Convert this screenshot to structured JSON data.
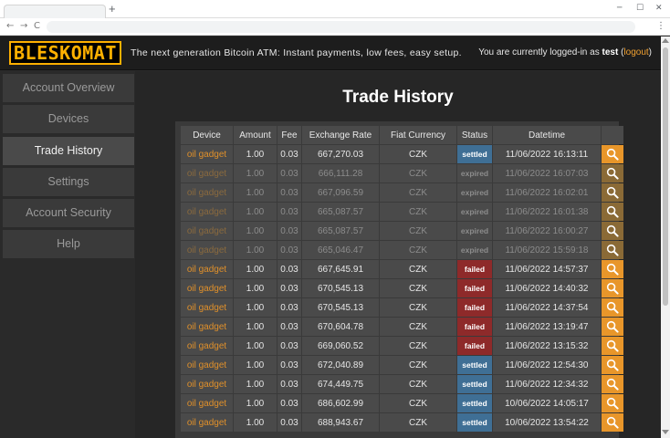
{
  "browser": {
    "new_tab": "+",
    "minimize": "─",
    "maximize": "☐",
    "close": "✕",
    "back": "←",
    "forward": "→",
    "reload": "C",
    "menu": "⋮"
  },
  "header": {
    "logo": "BLESKOMAT",
    "tagline": "The next generation Bitcoin ATM: Instant payments, low fees, easy setup.",
    "login_prefix": "You are currently logged-in as ",
    "username": "test",
    "logout_open": " (",
    "logout_label": "logout",
    "logout_close": ")"
  },
  "sidebar": {
    "items": [
      {
        "label": "Account Overview"
      },
      {
        "label": "Devices"
      },
      {
        "label": "Trade History"
      },
      {
        "label": "Settings"
      },
      {
        "label": "Account Security"
      },
      {
        "label": "Help"
      }
    ]
  },
  "main": {
    "title": "Trade History",
    "columns": [
      "Device",
      "Amount",
      "Fee",
      "Exchange Rate",
      "Fiat Currency",
      "Status",
      "Datetime"
    ],
    "rows": [
      {
        "device": "oil gadget",
        "amount": "1.00",
        "fee": "0.03",
        "rate": "667,270.03",
        "fiat": "CZK",
        "status": "settled",
        "datetime": "11/06/2022 16:13:11"
      },
      {
        "device": "oil gadget",
        "amount": "1.00",
        "fee": "0.03",
        "rate": "666,111.28",
        "fiat": "CZK",
        "status": "expired",
        "datetime": "11/06/2022 16:07:03"
      },
      {
        "device": "oil gadget",
        "amount": "1.00",
        "fee": "0.03",
        "rate": "667,096.59",
        "fiat": "CZK",
        "status": "expired",
        "datetime": "11/06/2022 16:02:01"
      },
      {
        "device": "oil gadget",
        "amount": "1.00",
        "fee": "0.03",
        "rate": "665,087.57",
        "fiat": "CZK",
        "status": "expired",
        "datetime": "11/06/2022 16:01:38"
      },
      {
        "device": "oil gadget",
        "amount": "1.00",
        "fee": "0.03",
        "rate": "665,087.57",
        "fiat": "CZK",
        "status": "expired",
        "datetime": "11/06/2022 16:00:27"
      },
      {
        "device": "oil gadget",
        "amount": "1.00",
        "fee": "0.03",
        "rate": "665,046.47",
        "fiat": "CZK",
        "status": "expired",
        "datetime": "11/06/2022 15:59:18"
      },
      {
        "device": "oil gadget",
        "amount": "1.00",
        "fee": "0.03",
        "rate": "667,645.91",
        "fiat": "CZK",
        "status": "failed",
        "datetime": "11/06/2022 14:57:37"
      },
      {
        "device": "oil gadget",
        "amount": "1.00",
        "fee": "0.03",
        "rate": "670,545.13",
        "fiat": "CZK",
        "status": "failed",
        "datetime": "11/06/2022 14:40:32"
      },
      {
        "device": "oil gadget",
        "amount": "1.00",
        "fee": "0.03",
        "rate": "670,545.13",
        "fiat": "CZK",
        "status": "failed",
        "datetime": "11/06/2022 14:37:54"
      },
      {
        "device": "oil gadget",
        "amount": "1.00",
        "fee": "0.03",
        "rate": "670,604.78",
        "fiat": "CZK",
        "status": "failed",
        "datetime": "11/06/2022 13:19:47"
      },
      {
        "device": "oil gadget",
        "amount": "1.00",
        "fee": "0.03",
        "rate": "669,060.52",
        "fiat": "CZK",
        "status": "failed",
        "datetime": "11/06/2022 13:15:32"
      },
      {
        "device": "oil gadget",
        "amount": "1.00",
        "fee": "0.03",
        "rate": "672,040.89",
        "fiat": "CZK",
        "status": "settled",
        "datetime": "11/06/2022 12:54:30"
      },
      {
        "device": "oil gadget",
        "amount": "1.00",
        "fee": "0.03",
        "rate": "674,449.75",
        "fiat": "CZK",
        "status": "settled",
        "datetime": "11/06/2022 12:34:32"
      },
      {
        "device": "oil gadget",
        "amount": "1.00",
        "fee": "0.03",
        "rate": "686,602.99",
        "fiat": "CZK",
        "status": "settled",
        "datetime": "10/06/2022 14:05:17"
      },
      {
        "device": "oil gadget",
        "amount": "1.00",
        "fee": "0.03",
        "rate": "688,943.67",
        "fiat": "CZK",
        "status": "settled",
        "datetime": "10/06/2022 13:54:22"
      }
    ]
  },
  "icons": {
    "view": "magnifier-icon"
  },
  "colors": {
    "accent": "#e8962a",
    "settled": "#3f6f95",
    "failed": "#8e2a2a",
    "logo": "#ffb000"
  }
}
